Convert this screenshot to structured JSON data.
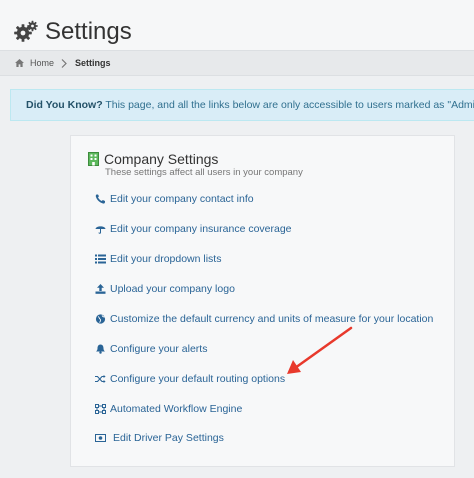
{
  "header": {
    "title": "Settings",
    "icon": "gears-icon"
  },
  "breadcrumb": {
    "home": "Home",
    "current": "Settings"
  },
  "notice": {
    "bold": "Did You Know?",
    "text": " This page, and all the links below are only accessible to users marked as \"Administra"
  },
  "panel": {
    "title": "Company Settings",
    "subtitle": "These settings affect all users in your company",
    "links": [
      {
        "label": "Edit your company contact info",
        "icon": "phone-icon"
      },
      {
        "label": "Edit your company insurance coverage",
        "icon": "umbrella-icon"
      },
      {
        "label": "Edit your dropdown lists",
        "icon": "list-icon"
      },
      {
        "label": "Upload your company logo",
        "icon": "upload-icon"
      },
      {
        "label": "Customize the default currency and units of measure for your location",
        "icon": "globe-icon"
      },
      {
        "label": "Configure your alerts",
        "icon": "bell-icon"
      },
      {
        "label": "Configure your default routing options",
        "icon": "shuffle-icon"
      },
      {
        "label": "Automated Workflow Engine",
        "icon": "workflow-icon"
      },
      {
        "label": "Edit Driver Pay Settings",
        "icon": "money-icon"
      }
    ]
  },
  "colors": {
    "link": "#2a6496",
    "annotation_arrow": "#e8392c",
    "notice_bg": "#d9edf7"
  }
}
